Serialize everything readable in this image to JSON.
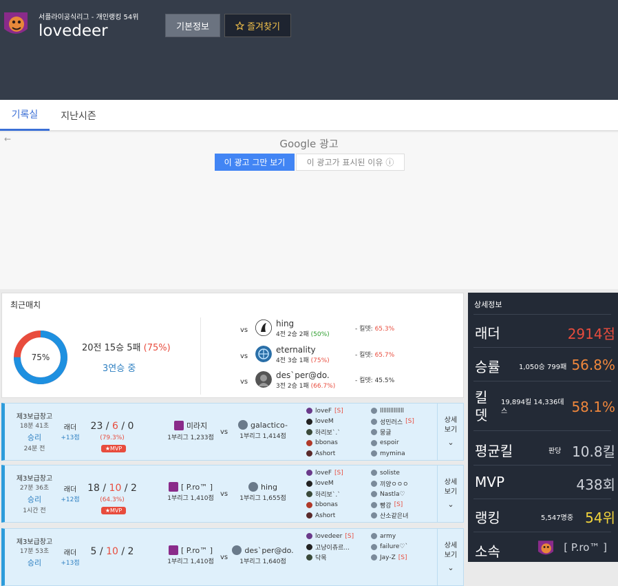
{
  "header": {
    "league_info": "서플라이공식리그 - 개인랭킹 54위",
    "player_name": "lovedeer",
    "info_button": "기본정보",
    "favorite_button": "즐겨찾기"
  },
  "tabs": {
    "records": "기록실",
    "past_seasons": "지난시즌"
  },
  "ad": {
    "back_arrow": "←",
    "brand": "Google",
    "label": "광고",
    "stop_button": "이 광고 그만 보기",
    "why_button": "이 광고가 표시된 이유",
    "why_icon": "ⓘ"
  },
  "recent": {
    "title": "최근매치",
    "donut_label": "75%",
    "win_rate": 0.75,
    "summary_prefix": "20전 15승 5패",
    "summary_pct": "(75%)",
    "streak": "3연승 중",
    "opponents": [
      {
        "vs": "vs",
        "name": "hing",
        "record": "4전 2승 2패",
        "record_pct": "(50%)",
        "pct_color": "green",
        "kd_label": "- 킬뎃:",
        "kd": "65.3%",
        "kd_red": true
      },
      {
        "vs": "vs",
        "name": "eternality",
        "record": "4전 3승 1패",
        "record_pct": "(75%)",
        "pct_color": "red",
        "kd_label": "- 킬뎃:",
        "kd": "65.7%",
        "kd_red": true
      },
      {
        "vs": "vs",
        "name": "des`per@do.",
        "record": "3전 2승 1패",
        "record_pct": "(66.7%)",
        "pct_color": "red",
        "kd_label": "- 킬뎃:",
        "kd": "45.5%",
        "kd_red": false
      }
    ]
  },
  "matches": [
    {
      "map": "제3보급창고",
      "duration": "18분 41초",
      "result": "승리",
      "ago": "24분 전",
      "type": "래더",
      "points": "+13점",
      "k": "23",
      "d": "6",
      "a": "0",
      "sep": " / ",
      "rate": "(79.3%)",
      "mvp": "MVP",
      "p1": {
        "name": "미라지",
        "rank": "1부리그 1,233점"
      },
      "vs": "vs",
      "p2": {
        "name": "galactico-",
        "rank": "1부리그 1,414점"
      },
      "team_a": [
        {
          "n": "loveF",
          "s": "[S]"
        },
        {
          "n": "loveM",
          "s": ""
        },
        {
          "n": "하리보`.`",
          "s": ""
        },
        {
          "n": "bbonas",
          "s": ""
        },
        {
          "n": "Ashort",
          "s": ""
        }
      ],
      "team_b": [
        {
          "n": "llllllllllllll",
          "s": ""
        },
        {
          "n": "성민러스",
          "s": "[S]"
        },
        {
          "n": "뭉글",
          "s": ""
        },
        {
          "n": "espoir",
          "s": ""
        },
        {
          "n": "mymina",
          "s": ""
        }
      ],
      "detail": "상세\n보기"
    },
    {
      "map": "제3보급창고",
      "duration": "27분 36초",
      "result": "승리",
      "ago": "1시간 전",
      "type": "래더",
      "points": "+12점",
      "k": "18",
      "d": "10",
      "a": "2",
      "sep": " / ",
      "rate": "(64.3%)",
      "mvp": "MVP",
      "p1": {
        "name": "[ P.ro™ ]",
        "rank": "1부리그 1,410점"
      },
      "vs": "vs",
      "p2": {
        "name": "hing",
        "rank": "1부리그 1,655점"
      },
      "team_a": [
        {
          "n": "loveF",
          "s": "[S]"
        },
        {
          "n": "loveM",
          "s": ""
        },
        {
          "n": "하리보`.`",
          "s": ""
        },
        {
          "n": "bbonas",
          "s": ""
        },
        {
          "n": "Ashort",
          "s": ""
        }
      ],
      "team_b": [
        {
          "n": "soliste",
          "s": ""
        },
        {
          "n": "끼양ㅇㅇㅇ",
          "s": ""
        },
        {
          "n": "Nastla♡",
          "s": ""
        },
        {
          "n": "빵강",
          "s": "[S]"
        },
        {
          "n": "산소같은녀",
          "s": ""
        }
      ],
      "detail": "상세\n보기"
    },
    {
      "map": "제3보급창고",
      "duration": "17분 53초",
      "result": "승리",
      "ago": "",
      "type": "래더",
      "points": "+13점",
      "k": "5",
      "d": "10",
      "a": "2",
      "sep": " / ",
      "rate": "",
      "mvp": "",
      "p1": {
        "name": "[ P.ro™ ]",
        "rank": "1부리그 1,410점"
      },
      "vs": "vs",
      "p2": {
        "name": "des`per@do.",
        "rank": "1부리그 1,640점"
      },
      "team_a": [
        {
          "n": "lovedeer",
          "s": "[S]"
        },
        {
          "n": "고냥이츄르...",
          "s": ""
        },
        {
          "n": "닥목",
          "s": ""
        }
      ],
      "team_b": [
        {
          "n": "army",
          "s": ""
        },
        {
          "n": "failure♡`",
          "s": ""
        },
        {
          "n": "Jay-Z",
          "s": "[S]"
        }
      ],
      "detail": "상세\n보기"
    }
  ],
  "side": {
    "title": "상세정보",
    "ladder": {
      "label": "래더",
      "value": "2914점"
    },
    "winrate": {
      "label": "승률",
      "sub": "1,050승 799패",
      "value": "56.8%"
    },
    "kd": {
      "label": "킬뎃",
      "sub1": "19,894킬 14,336데",
      "sub2": "스",
      "value": "58.1%"
    },
    "avgkill": {
      "label": "평균킬",
      "sub": "판당",
      "value": "10.8킬"
    },
    "mvp": {
      "label": "MVP",
      "value": "438회"
    },
    "rank": {
      "label": "랭킹",
      "sub": "5,547명중",
      "value": "54위"
    },
    "clan": {
      "label": "소속",
      "value": "[ P.ro™ ]"
    }
  },
  "colors": {
    "header_bg": "#353d4a",
    "accent_blue": "#2d7fc1",
    "red": "#e84c3d",
    "side_bg": "#232a36",
    "donut_blue": "#1e90e0",
    "donut_red": "#e84c3d"
  },
  "icons": {
    "star": "star-icon",
    "chevron": "chevron-down-icon"
  }
}
